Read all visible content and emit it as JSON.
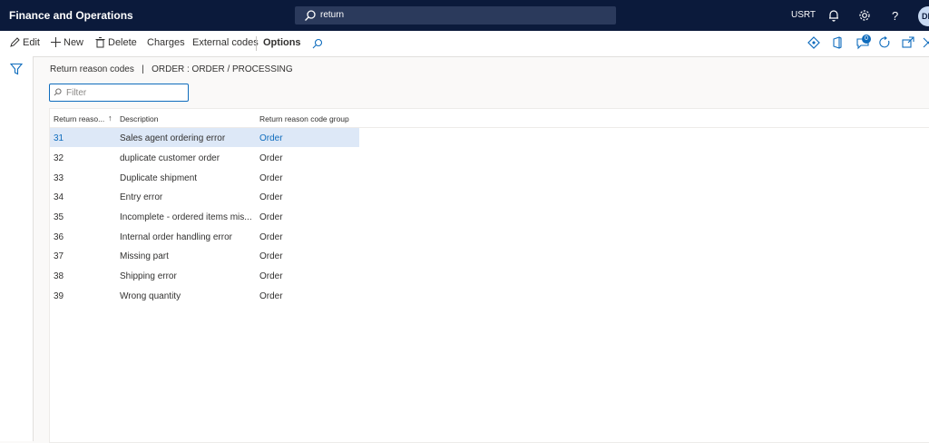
{
  "app": {
    "title": "Finance and Operations",
    "search_value": "return",
    "company": "USRT",
    "avatar_initials": "DE"
  },
  "actions": {
    "edit": "Edit",
    "new": "New",
    "delete": "Delete",
    "charges": "Charges",
    "external_codes": "External codes",
    "options": "Options"
  },
  "badges": {
    "notifications_count": "0"
  },
  "breadcrumb": "Return reason codes   |   ORDER : ORDER / PROCESSING",
  "filter": {
    "placeholder": "Filter",
    "value": ""
  },
  "grid": {
    "columns": [
      "Return reaso...",
      "Description",
      "Return reason code group"
    ],
    "sort_indicator": "↑",
    "rows": [
      {
        "code": "31",
        "description": "Sales agent ordering error",
        "group": "Order",
        "selected": true
      },
      {
        "code": "32",
        "description": "duplicate customer order",
        "group": "Order"
      },
      {
        "code": "33",
        "description": "Duplicate shipment",
        "group": "Order"
      },
      {
        "code": "34",
        "description": "Entry error",
        "group": "Order"
      },
      {
        "code": "35",
        "description": "Incomplete - ordered items mis...",
        "group": "Order"
      },
      {
        "code": "36",
        "description": "Internal order handling error",
        "group": "Order"
      },
      {
        "code": "37",
        "description": "Missing part",
        "group": "Order"
      },
      {
        "code": "38",
        "description": "Shipping error",
        "group": "Order"
      },
      {
        "code": "39",
        "description": "Wrong quantity",
        "group": "Order"
      }
    ]
  },
  "colors": {
    "navy": "#0b1a3b",
    "accent": "#0f6cbd",
    "selected_row": "#dde8f7"
  }
}
